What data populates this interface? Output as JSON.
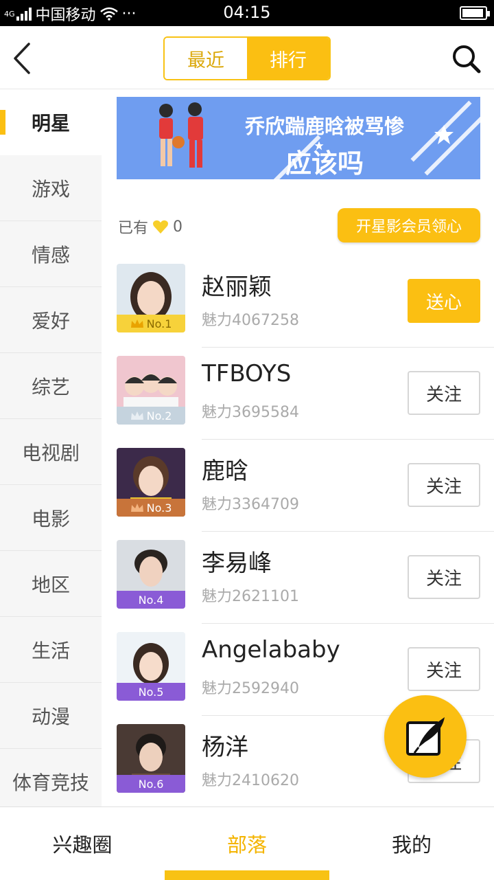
{
  "status_bar": {
    "network": "4G",
    "carrier": "中国移动",
    "more": "···",
    "time": "04:15"
  },
  "header": {
    "tabs": [
      {
        "label": "最近",
        "active": false
      },
      {
        "label": "排行",
        "active": true
      }
    ]
  },
  "sidebar": {
    "items": [
      {
        "label": "明星",
        "active": true
      },
      {
        "label": "游戏"
      },
      {
        "label": "情感"
      },
      {
        "label": "爱好"
      },
      {
        "label": "综艺"
      },
      {
        "label": "电视剧"
      },
      {
        "label": "电影"
      },
      {
        "label": "地区"
      },
      {
        "label": "生活"
      },
      {
        "label": "动漫"
      },
      {
        "label": "体育竞技"
      }
    ]
  },
  "banner": {
    "line1": "乔欣踹鹿晗被骂惨",
    "line2": "应该吗"
  },
  "hearts": {
    "label": "已有",
    "count": "0",
    "vip_button": "开星影会员领心"
  },
  "rank_list": [
    {
      "rank": "No.1",
      "name": "赵丽颖",
      "charm": "魅力4067258",
      "action": "送心",
      "badge_color": "#f7d23a"
    },
    {
      "rank": "No.2",
      "name": "TFBOYS",
      "charm": "魅力3695584",
      "action": "关注",
      "badge_color": "#b9c9d6"
    },
    {
      "rank": "No.3",
      "name": "鹿晗",
      "charm": "魅力3364709",
      "action": "关注",
      "badge_color": "#c8743a"
    },
    {
      "rank": "No.4",
      "name": "李易峰",
      "charm": "魅力2621101",
      "action": "关注",
      "badge_color": "#8a5bd6"
    },
    {
      "rank": "No.5",
      "name": "Angelababy",
      "charm": "魅力2592940",
      "action": "关注",
      "badge_color": "#8a5bd6"
    },
    {
      "rank": "No.6",
      "name": "杨洋",
      "charm": "魅力2410620",
      "action": "关注",
      "badge_color": "#8a5bd6"
    }
  ],
  "bottom_nav": {
    "items": [
      {
        "label": "兴趣圈",
        "active": false
      },
      {
        "label": "部落",
        "active": true
      },
      {
        "label": "我的",
        "active": false
      }
    ]
  },
  "colors": {
    "accent": "#fbbf12",
    "banner_bg": "#6f9df0"
  }
}
